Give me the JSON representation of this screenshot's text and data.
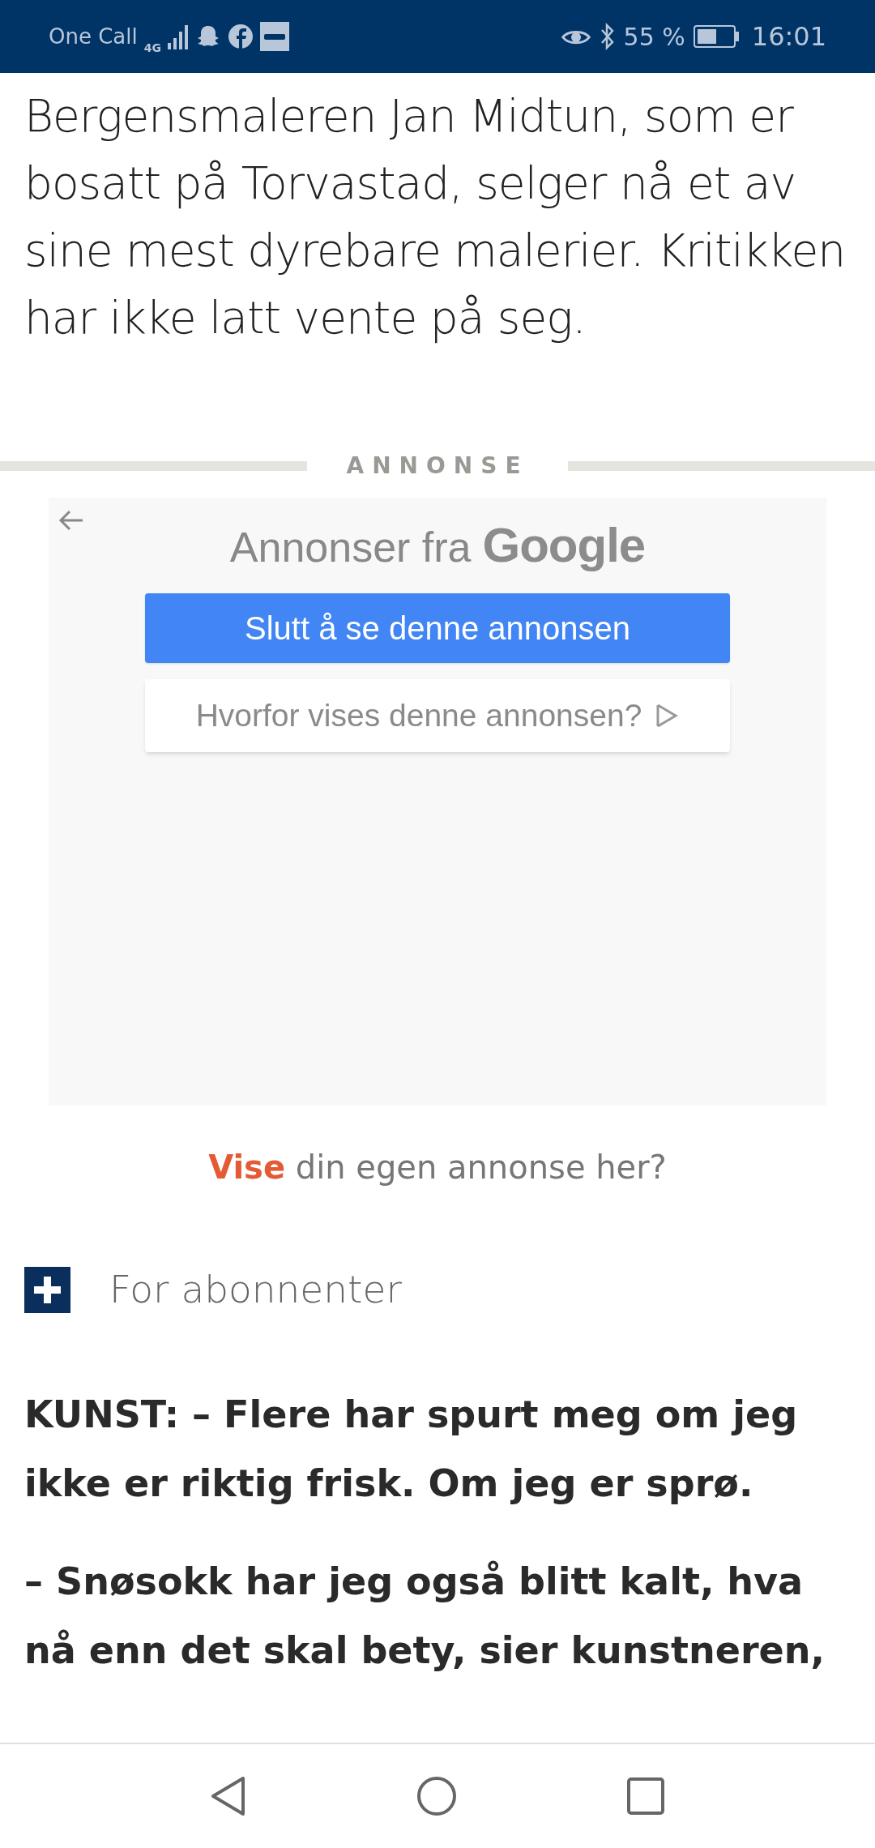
{
  "status_bar": {
    "carrier": "One Call",
    "network": "4G",
    "battery": "55 %",
    "time": "16:01"
  },
  "lead": "Bergensmaleren Jan Midtun, som er bosatt på Torvastad, selger nå et av sine mest dyrebare malerier. Kritikken har ikke latt vente på seg.",
  "ad": {
    "label": "ANNONSE",
    "header": "Annonser fra",
    "brand": "Google",
    "stop_button": "Slutt å se denne annonsen",
    "why_button": "Hvorfor vises denne annonsen?"
  },
  "promo": "**Vise** din egen annonse her?",
  "subscriber_badge": "For abonnenter",
  "paragraphs": [
    "KUNST: – Flere har spurt meg om jeg ikke er riktig frisk. Om jeg er sprø.",
    "– Snøsokk har jeg også blitt kalt, hva nå enn det skal bety, sier kunstneren,"
  ]
}
